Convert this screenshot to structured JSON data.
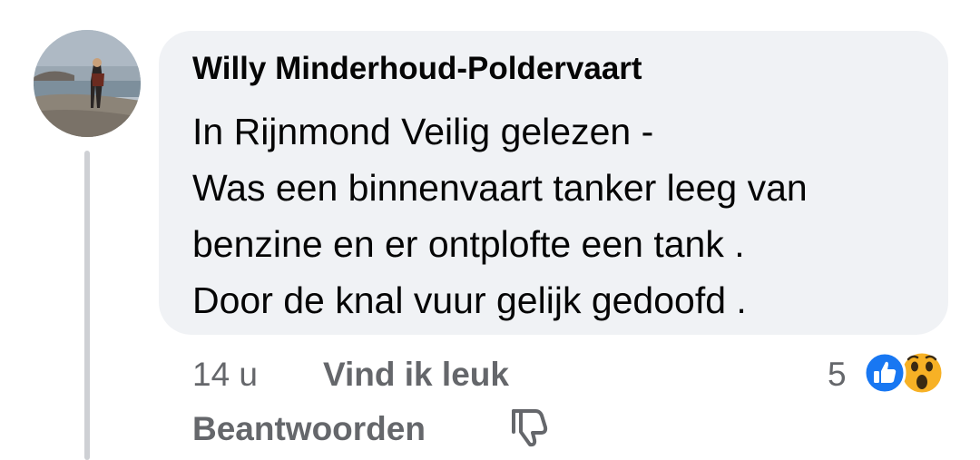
{
  "comment": {
    "author": "Willy Minderhoud-Poldervaart",
    "text_lines": [
      "In Rijnmond Veilig gelezen -",
      "Was een binnenvaart tanker leeg van",
      "benzine en er ontplofte een tank .",
      "Door de knal vuur gelijk gedoofd ."
    ],
    "time": "14 u",
    "like_label": "Vind ik leuk",
    "reply_label": "Beantwoorden",
    "reaction_count": "5",
    "reactions": [
      "like-icon",
      "wow-icon"
    ]
  },
  "colors": {
    "bubble": "#f0f2f5",
    "text": "#050505",
    "secondary": "#65676b",
    "like_blue": "#1877f2",
    "wow_yellow": "#f7b125"
  }
}
